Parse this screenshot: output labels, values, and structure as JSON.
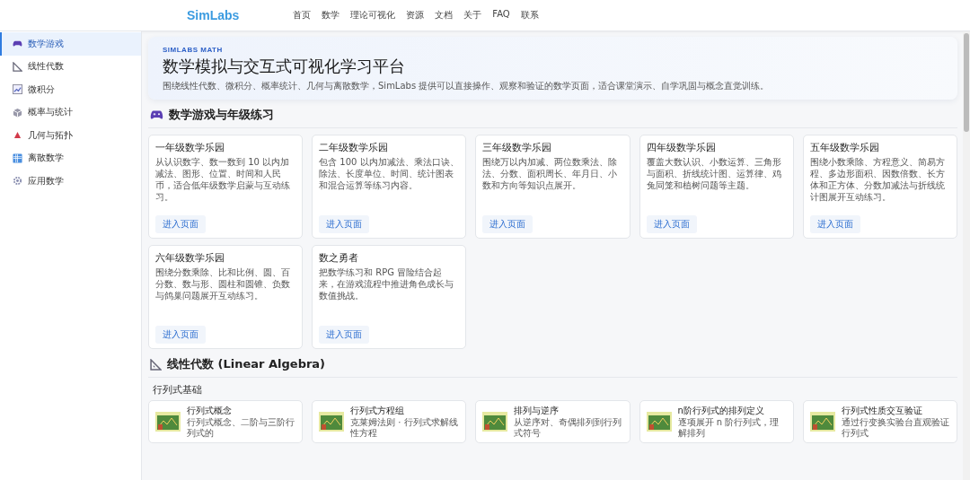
{
  "header": {
    "logo": "SimLabs",
    "nav": [
      {
        "label": "首页"
      },
      {
        "label": "数学"
      },
      {
        "label": "理论可视化"
      },
      {
        "label": "资源"
      },
      {
        "label": "文档"
      },
      {
        "label": "关于"
      },
      {
        "label": "FAQ"
      },
      {
        "label": "联系"
      }
    ]
  },
  "sidebar": {
    "items": [
      {
        "label": "数学游戏",
        "selected": true
      },
      {
        "label": "线性代数",
        "selected": false
      },
      {
        "label": "微积分",
        "selected": false
      },
      {
        "label": "概率与统计",
        "selected": false
      },
      {
        "label": "几何与拓扑",
        "selected": false
      },
      {
        "label": "离散数学",
        "selected": false
      },
      {
        "label": "应用数学",
        "selected": false
      }
    ]
  },
  "hero": {
    "eyebrow": "SIMLABS MATH",
    "title": "数学模拟与交互式可视化学习平台",
    "description": "围绕线性代数、微积分、概率统计、几何与离散数学，SimLabs 提供可以直接操作、观察和验证的数学页面，适合课堂演示、自学巩固与概念直觉训练。"
  },
  "sections": [
    {
      "title": "数学游戏与年级练习",
      "groups": [
        {
          "cards": [
            {
              "kind": "text",
              "title": "一年级数学乐园",
              "description": "从认识数字、数一数到 10 以内加减法、图形、位置、时间和人民币，适合低年级数学启蒙与互动练习。",
              "button": "进入页面"
            },
            {
              "kind": "text",
              "title": "二年级数学乐园",
              "description": "包含 100 以内加减法、乘法口诀、除法、长度单位、时间、统计图表和混合运算等练习内容。",
              "button": "进入页面"
            },
            {
              "kind": "text",
              "title": "三年级数学乐园",
              "description": "围绕万以内加减、两位数乘法、除法、分数、面积周长、年月日、小数和方向等知识点展开。",
              "button": "进入页面"
            },
            {
              "kind": "text",
              "title": "四年级数学乐园",
              "description": "覆盖大数认识、小数运算、三角形与面积、折线统计图、运算律、鸡兔同笼和植树问题等主题。",
              "button": "进入页面"
            },
            {
              "kind": "text",
              "title": "五年级数学乐园",
              "description": "围绕小数乘除、方程意义、简易方程、多边形面积、因数倍数、长方体和正方体、分数加减法与折线统计图展开互动练习。",
              "button": "进入页面"
            },
            {
              "kind": "text",
              "title": "六年级数学乐园",
              "description": "围绕分数乘除、比和比例、圆、百分数、数与形、圆柱和圆锥、负数与鸽巢问题展开互动练习。",
              "button": "进入页面"
            },
            {
              "kind": "text",
              "title": "数之勇者",
              "description": "把数学练习和 RPG 冒险结合起来，在游戏流程中推进角色成长与数值挑战。",
              "button": "进入页面"
            }
          ]
        }
      ]
    },
    {
      "title": "线性代数 (Linear Algebra)",
      "groups": [
        {
          "title": "行列式基础",
          "cards": [
            {
              "kind": "thumb",
              "title": "行列式概念",
              "description": "行列式概念、二阶与三阶行列式的"
            },
            {
              "kind": "thumb",
              "title": "行列式方程组",
              "description": "克莱姆法则 · 行列式求解线性方程"
            },
            {
              "kind": "thumb",
              "title": "排列与逆序",
              "description": "从逆序对、奇偶排列到行列式符号"
            },
            {
              "kind": "thumb",
              "title": "n阶行列式的排列定义",
              "description": "逐项展开 n 阶行列式，理解排列"
            },
            {
              "kind": "thumb",
              "title": "行列式性质交互验证",
              "description": "通过行变换实验台直观验证行列式"
            }
          ]
        }
      ]
    }
  ]
}
